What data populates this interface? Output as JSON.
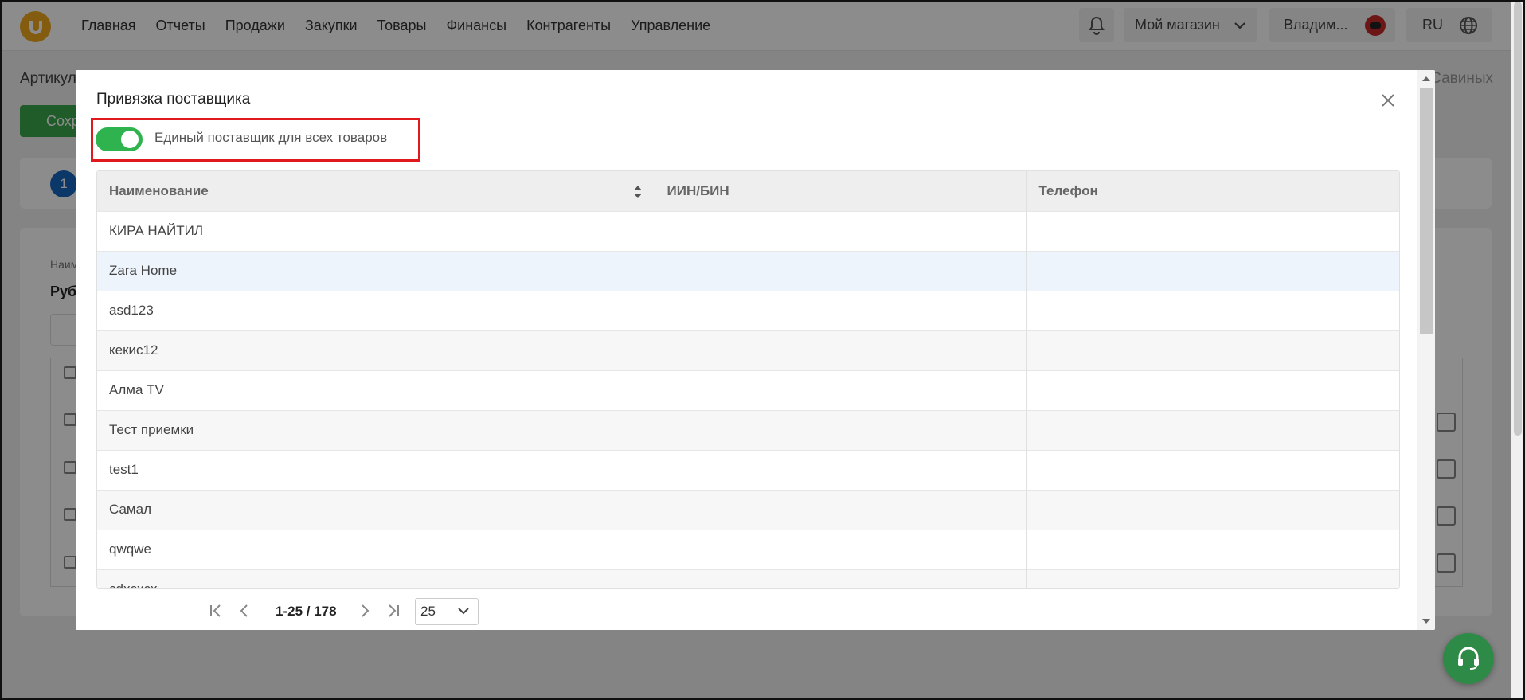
{
  "nav": {
    "items": [
      "Главная",
      "Отчеты",
      "Продажи",
      "Закупки",
      "Товары",
      "Финансы",
      "Контрагенты",
      "Управление"
    ],
    "store": "Мой магазин",
    "user": "Владим...",
    "lang": "RU"
  },
  "background": {
    "title": "Артикул",
    "right_text": "Савиных",
    "save_button": "Сохр",
    "step": "1",
    "label": "Наим",
    "value": "Руба"
  },
  "modal": {
    "title": "Привязка поставщика",
    "toggle_label": "Единый поставщик для всех товаров",
    "toggle_on": true,
    "columns": [
      "Наименование",
      "ИИН/БИН",
      "Телефон"
    ],
    "rows": [
      {
        "name": "КИРА НАЙТИЛ",
        "iin": "",
        "phone": ""
      },
      {
        "name": "Zara Home",
        "iin": "",
        "phone": ""
      },
      {
        "name": "asd123",
        "iin": "",
        "phone": ""
      },
      {
        "name": "кекис12",
        "iin": "",
        "phone": ""
      },
      {
        "name": "Алма TV",
        "iin": "",
        "phone": ""
      },
      {
        "name": "Тест приемки",
        "iin": "",
        "phone": ""
      },
      {
        "name": "test1",
        "iin": "",
        "phone": ""
      },
      {
        "name": "Самал",
        "iin": "",
        "phone": ""
      },
      {
        "name": "qwqwe",
        "iin": "",
        "phone": ""
      },
      {
        "name": "cdxcxcx",
        "iin": "",
        "phone": ""
      }
    ],
    "pager": {
      "range": "1-25 / 178",
      "page_size": "25"
    }
  },
  "colors": {
    "accent": "#2fb34e",
    "highlight": "#e0191e",
    "logo": "#f0a81d"
  }
}
